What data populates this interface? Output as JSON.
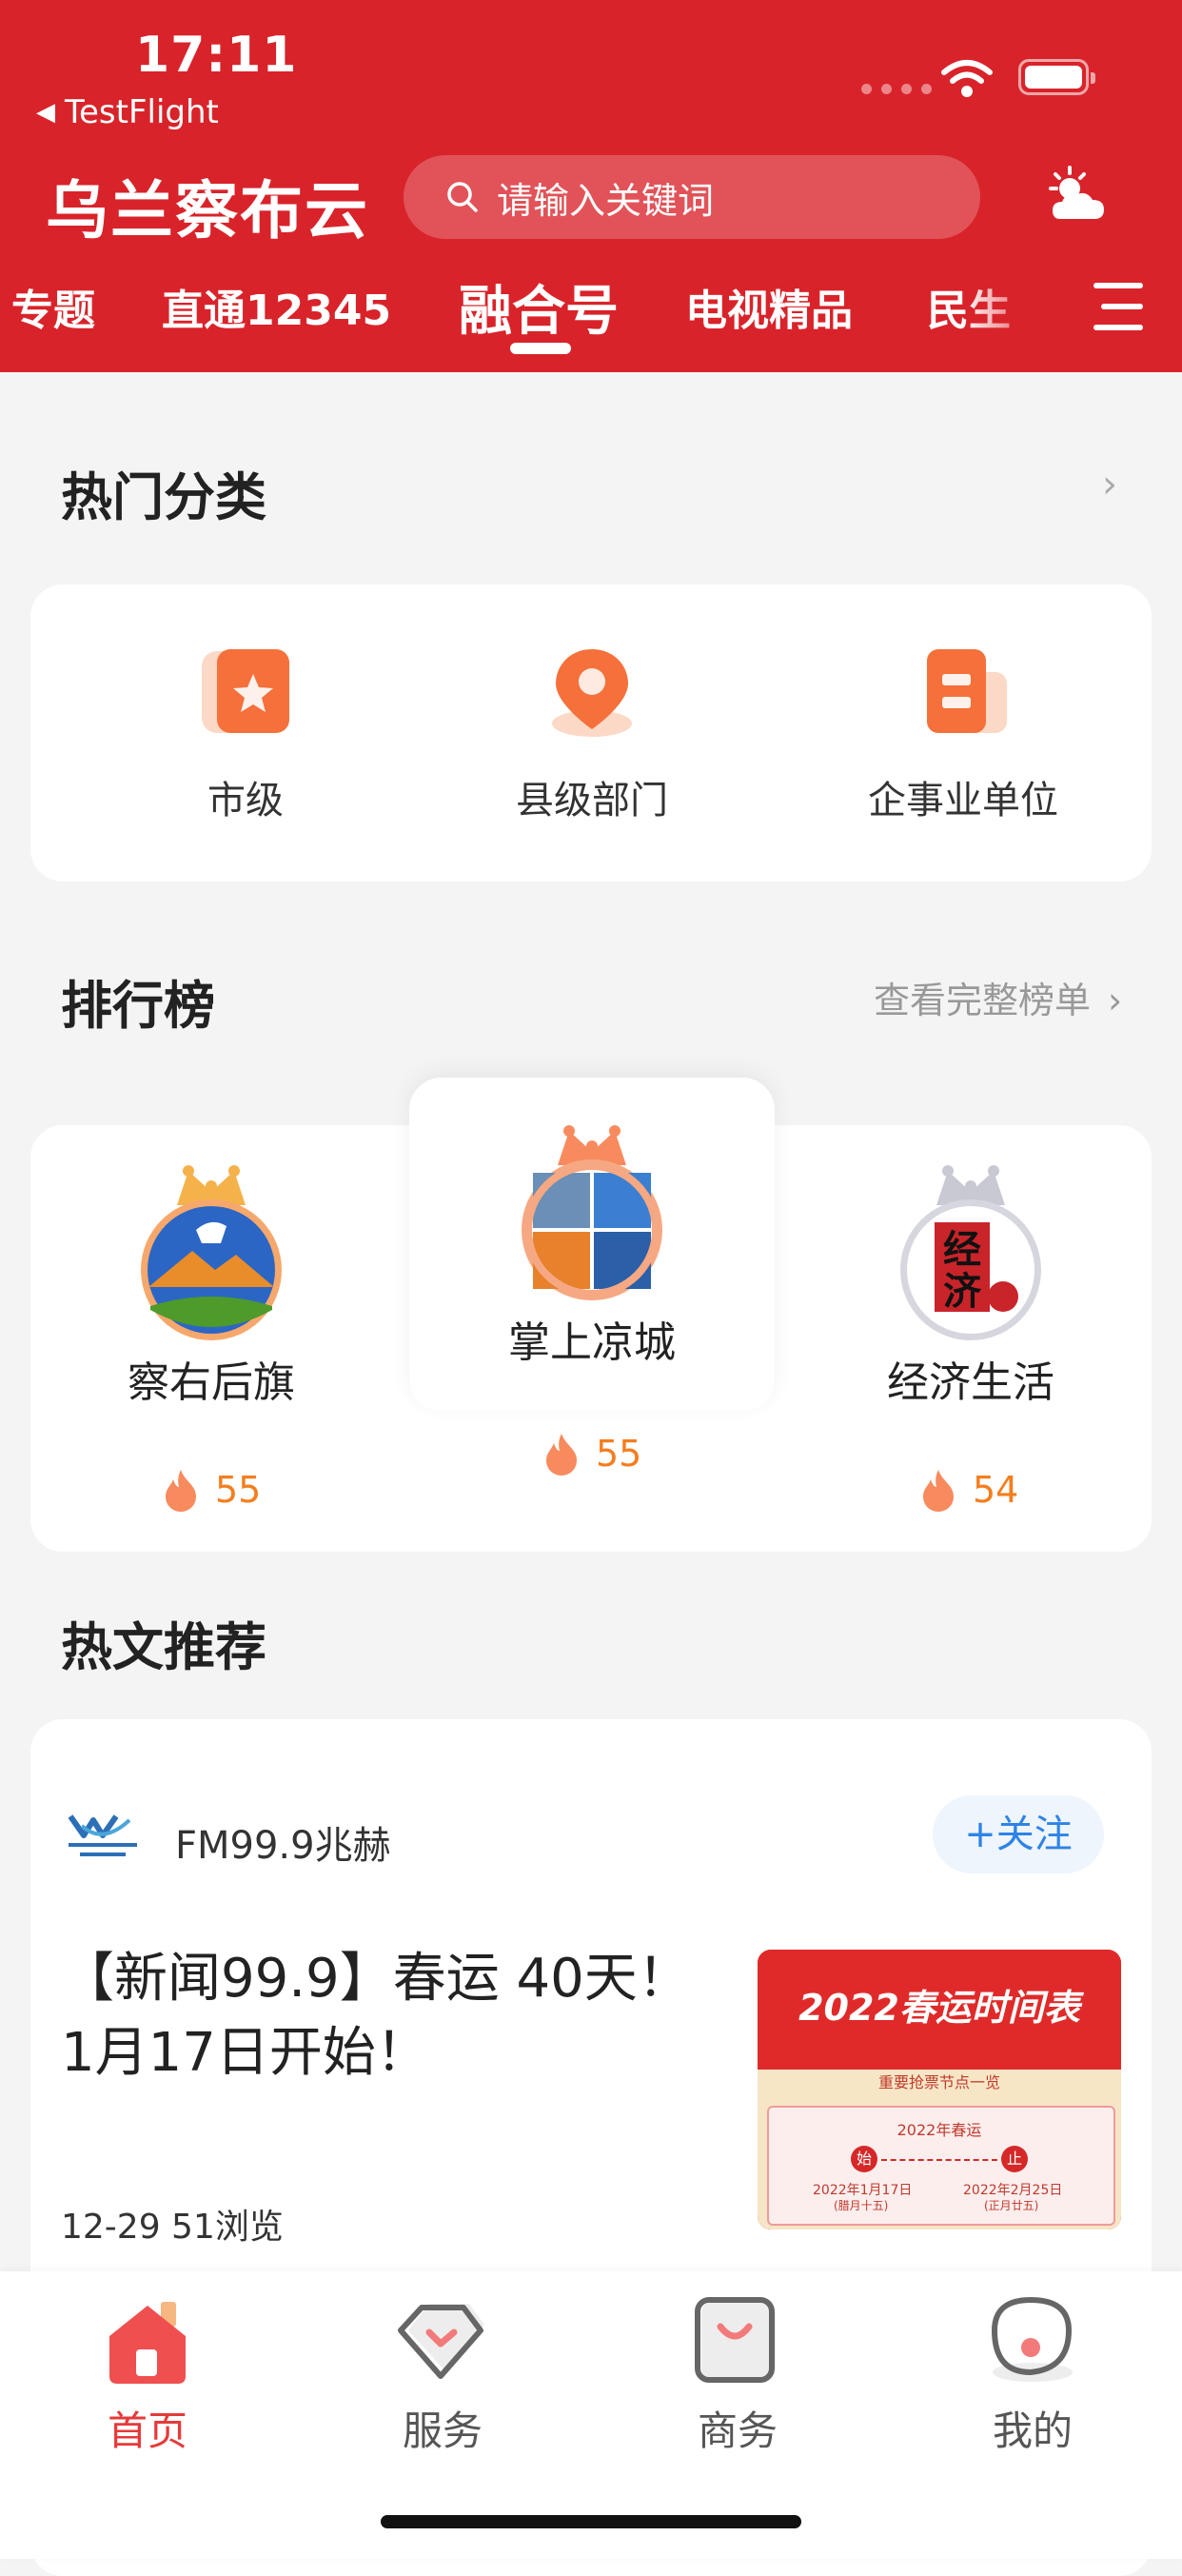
{
  "status_bar": {
    "time": "17:11",
    "back_app": "TestFlight"
  },
  "header": {
    "app_title": "乌兰察布云",
    "search_placeholder": "请输入关键词",
    "tabs": [
      "专题",
      "直通12345",
      "融合号",
      "电视精品",
      "民生"
    ],
    "active_tab": "融合号"
  },
  "hot_categories": {
    "title": "热门分类",
    "items": [
      {
        "label": "市级",
        "icon": "star-icon"
      },
      {
        "label": "县级部门",
        "icon": "location-pin-icon"
      },
      {
        "label": "企事业单位",
        "icon": "building-icon"
      }
    ]
  },
  "ranking": {
    "title": "排行榜",
    "more_label": "查看完整榜单",
    "items": [
      {
        "rank": 2,
        "name": "察右后旗",
        "score": "55"
      },
      {
        "rank": 1,
        "name": "掌上凉城",
        "score": "55"
      },
      {
        "rank": 3,
        "name": "经济生活",
        "score": "54"
      }
    ]
  },
  "hot_articles": {
    "title": "热文推荐",
    "article": {
      "source": "FM99.9兆赫",
      "follow_label": "+关注",
      "title": "【新闻99.9】春运 40天！1月17日开始！",
      "meta": "12-29 51浏览",
      "thumb": {
        "heading": "2022春运时间表",
        "subheading": "重要抢票节点一览",
        "label": "2022年春运",
        "start_badge": "始",
        "end_badge": "止",
        "start_date": "2022年1月17日",
        "start_lunar": "(腊月十五)",
        "end_date": "2022年2月25日",
        "end_lunar": "(正月廿五)"
      }
    }
  },
  "tabbar": {
    "items": [
      {
        "label": "首页",
        "icon": "home-icon",
        "active": true
      },
      {
        "label": "服务",
        "icon": "service-icon",
        "active": false
      },
      {
        "label": "商务",
        "icon": "shopping-bag-icon",
        "active": false
      },
      {
        "label": "我的",
        "icon": "profile-icon",
        "active": false
      }
    ]
  },
  "colors": {
    "brand_red": "#d9232a",
    "accent_orange": "#f47e1f",
    "follow_blue": "#2e83e6"
  }
}
